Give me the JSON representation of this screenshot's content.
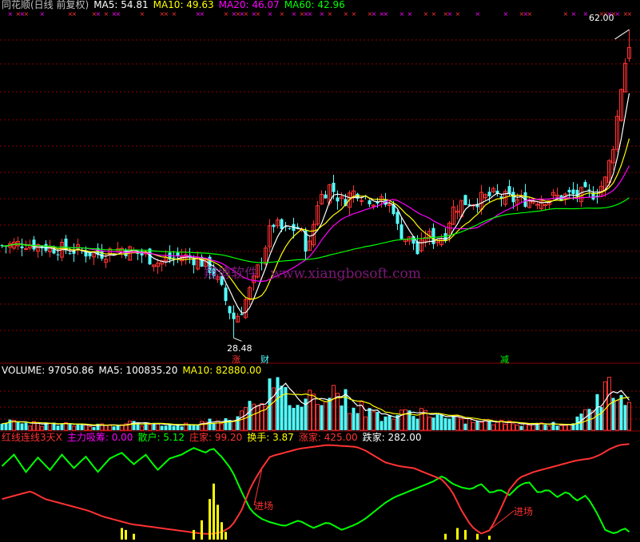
{
  "header_main": {
    "title": "同花顺(日线 前复权)",
    "ma5": "MA5: 54.81",
    "ma10": "MA10: 49.63",
    "ma20": "MA20: 46.07",
    "ma60": "MA60: 42.96"
  },
  "header_volume": {
    "volume": "VOLUME: 97050.86",
    "ma5": "MA5: 100835.20",
    "ma10": "MA10: 82880.00"
  },
  "header_indicator": {
    "name": "红线连线3天X",
    "zlxc": "主力吸筹: 0.00",
    "sanhu": "散户: 5.12",
    "zhuangjia": "庄家: 99.20",
    "huanshou": "换手: 3.87",
    "zhangjia": "涨家: 425.00",
    "diejia": "跌家: 282.00"
  },
  "annotations": {
    "high_price": "62.00",
    "low_price": "28.48",
    "marker_zhang": "涨",
    "marker_cai": "财",
    "marker_jian": "减",
    "entry1": "进场",
    "entry2": "进场"
  },
  "watermark": {
    "cn": "翔博软件",
    "url": "www.xiangbosoft.com"
  },
  "colors": {
    "up": "#ff3232",
    "down": "#54ffff",
    "ma5": "#ffffff",
    "ma10": "#ffff00",
    "ma20": "#ff00ff",
    "ma60": "#00ff00",
    "grid": "#8b0000"
  },
  "chart_data": [
    {
      "type": "candlestick",
      "title": "同花顺(日线 前复权)",
      "ylim": [
        26,
        64
      ],
      "x_count": 158,
      "price_path": [
        [
          0,
          38.5
        ],
        [
          10,
          38.8
        ],
        [
          20,
          38.3
        ],
        [
          30,
          38.0
        ],
        [
          40,
          37.6
        ],
        [
          50,
          38.2
        ],
        [
          60,
          37.4
        ],
        [
          65,
          36.7
        ],
        [
          75,
          37.4
        ],
        [
          82,
          37.0
        ],
        [
          88,
          35.8
        ],
        [
          92,
          33.5
        ],
        [
          95,
          31.5
        ],
        [
          97,
          30.5
        ],
        [
          100,
          31.5
        ],
        [
          105,
          34.5
        ],
        [
          110,
          38.5
        ],
        [
          113,
          41.0
        ],
        [
          118,
          40.0
        ],
        [
          124,
          40.5
        ],
        [
          128,
          37.8
        ],
        [
          132,
          43.5
        ],
        [
          137,
          45.0
        ],
        [
          142,
          43.2
        ],
        [
          145,
          44.0
        ],
        [
          148,
          44.5
        ],
        [
          152,
          43.8
        ],
        [
          157,
          43.4
        ],
        [
          162,
          42.8
        ],
        [
          164,
          42.5
        ],
        [
          165,
          40.5
        ],
        [
          168,
          39.5
        ],
        [
          172,
          38.8
        ],
        [
          174,
          37.4
        ],
        [
          177,
          39.8
        ],
        [
          180,
          39.2
        ],
        [
          185,
          39.6
        ],
        [
          188,
          42.4
        ],
        [
          192,
          43.2
        ],
        [
          198,
          43.4
        ],
        [
          205,
          44.0
        ],
        [
          215,
          43.4
        ],
        [
          225,
          43.6
        ],
        [
          232,
          43.8
        ],
        [
          238,
          44.0
        ],
        [
          248,
          44.2
        ],
        [
          252,
          45.6
        ],
        [
          255,
          49.0
        ],
        [
          257,
          52.5
        ],
        [
          259,
          56.5
        ],
        [
          261,
          59.5
        ],
        [
          262,
          60.5
        ]
      ],
      "high": 62.0,
      "low": 28.48,
      "series": [
        {
          "name": "MA5",
          "last": 54.81
        },
        {
          "name": "MA10",
          "last": 49.63
        },
        {
          "name": "MA20",
          "last": 46.07
        },
        {
          "name": "MA60",
          "last": 42.96
        }
      ]
    },
    {
      "type": "bar",
      "title": "VOLUME",
      "ylim": [
        0,
        140000
      ],
      "vol_path": [
        [
          0,
          22000
        ],
        [
          15,
          16000
        ],
        [
          30,
          14000
        ],
        [
          45,
          13000
        ],
        [
          52,
          22000
        ],
        [
          60,
          15000
        ],
        [
          75,
          14000
        ],
        [
          85,
          20000
        ],
        [
          90,
          30000
        ],
        [
          95,
          22000
        ],
        [
          100,
          60000
        ],
        [
          106,
          85000
        ],
        [
          110,
          95000
        ],
        [
          113,
          110000
        ],
        [
          118,
          90000
        ],
        [
          124,
          65000
        ],
        [
          130,
          92000
        ],
        [
          137,
          110000
        ],
        [
          142,
          85000
        ],
        [
          148,
          60000
        ],
        [
          152,
          50000
        ],
        [
          157,
          40000
        ],
        [
          165,
          35000
        ],
        [
          172,
          50000
        ],
        [
          178,
          45000
        ],
        [
          185,
          30000
        ],
        [
          195,
          24000
        ],
        [
          205,
          20000
        ],
        [
          215,
          18000
        ],
        [
          225,
          17000
        ],
        [
          235,
          16000
        ],
        [
          240,
          24000
        ],
        [
          246,
          60000
        ],
        [
          250,
          85000
        ],
        [
          254,
          110000
        ],
        [
          258,
          120000
        ],
        [
          262,
          100000
        ]
      ],
      "series": [
        {
          "name": "VOLUME",
          "last": 97050.86
        },
        {
          "name": "MA5",
          "last": 100835.2
        },
        {
          "name": "MA10",
          "last": 82880.0
        }
      ]
    },
    {
      "type": "line",
      "title": "红线连线3天X",
      "ylim": [
        0,
        100
      ],
      "series": [
        {
          "name": "散户",
          "last": 5.12,
          "path": [
            [
              0,
              76
            ],
            [
              5,
              88
            ],
            [
              10,
              70
            ],
            [
              15,
              85
            ],
            [
              20,
              72
            ],
            [
              25,
              88
            ],
            [
              30,
              74
            ],
            [
              35,
              86
            ],
            [
              40,
              70
            ],
            [
              45,
              84
            ],
            [
              50,
              90
            ],
            [
              55,
              78
            ],
            [
              60,
              88
            ],
            [
              65,
              72
            ],
            [
              70,
              84
            ],
            [
              75,
              88
            ],
            [
              80,
              95
            ],
            [
              85,
              90
            ],
            [
              88,
              95
            ],
            [
              92,
              85
            ],
            [
              96,
              72
            ],
            [
              100,
              50
            ],
            [
              104,
              30
            ],
            [
              108,
              22
            ],
            [
              112,
              18
            ],
            [
              118,
              14
            ],
            [
              124,
              20
            ],
            [
              130,
              12
            ],
            [
              136,
              18
            ],
            [
              142,
              10
            ],
            [
              148,
              16
            ],
            [
              152,
              22
            ],
            [
              156,
              30
            ],
            [
              160,
              38
            ],
            [
              164,
              44
            ],
            [
              168,
              48
            ],
            [
              172,
              52
            ],
            [
              176,
              56
            ],
            [
              180,
              60
            ],
            [
              184,
              66
            ],
            [
              188,
              58
            ],
            [
              192,
              54
            ],
            [
              196,
              52
            ],
            [
              200,
              58
            ],
            [
              204,
              48
            ],
            [
              208,
              52
            ],
            [
              212,
              46
            ],
            [
              216,
              56
            ],
            [
              220,
              60
            ],
            [
              224,
              48
            ],
            [
              228,
              52
            ],
            [
              232,
              44
            ],
            [
              236,
              50
            ],
            [
              240,
              40
            ],
            [
              244,
              46
            ],
            [
              248,
              30
            ],
            [
              252,
              10
            ],
            [
              256,
              6
            ],
            [
              260,
              12
            ],
            [
              262,
              8
            ]
          ]
        },
        {
          "name": "庄家",
          "last": 99.2,
          "path": [
            [
              0,
              42
            ],
            [
              6,
              46
            ],
            [
              12,
              50
            ],
            [
              18,
              42
            ],
            [
              24,
              38
            ],
            [
              30,
              34
            ],
            [
              36,
              30
            ],
            [
              42,
              24
            ],
            [
              48,
              20
            ],
            [
              54,
              16
            ],
            [
              60,
              14
            ],
            [
              66,
              12
            ],
            [
              72,
              10
            ],
            [
              78,
              8
            ],
            [
              84,
              6
            ],
            [
              88,
              6
            ],
            [
              92,
              8
            ],
            [
              96,
              14
            ],
            [
              100,
              30
            ],
            [
              104,
              55
            ],
            [
              108,
              72
            ],
            [
              112,
              86
            ],
            [
              118,
              90
            ],
            [
              124,
              94
            ],
            [
              130,
              96
            ],
            [
              136,
              98
            ],
            [
              142,
              97
            ],
            [
              148,
              96
            ],
            [
              152,
              92
            ],
            [
              156,
              86
            ],
            [
              160,
              80
            ],
            [
              166,
              76
            ],
            [
              172,
              74
            ],
            [
              178,
              68
            ],
            [
              184,
              62
            ],
            [
              188,
              50
            ],
            [
              192,
              30
            ],
            [
              196,
              14
            ],
            [
              200,
              6
            ],
            [
              204,
              10
            ],
            [
              208,
              30
            ],
            [
              212,
              52
            ],
            [
              216,
              64
            ],
            [
              222,
              70
            ],
            [
              228,
              74
            ],
            [
              234,
              78
            ],
            [
              240,
              82
            ],
            [
              246,
              84
            ],
            [
              250,
              88
            ],
            [
              254,
              94
            ],
            [
              258,
              98
            ],
            [
              262,
              99
            ]
          ]
        },
        {
          "name": "主力吸筹",
          "last": 0.0,
          "peaks": [
            [
              50,
              12
            ],
            [
              52,
              10
            ],
            [
              55,
              6
            ],
            [
              80,
              10
            ],
            [
              84,
              20
            ],
            [
              86,
              42
            ],
            [
              88,
              58
            ],
            [
              90,
              36
            ],
            [
              92,
              18
            ],
            [
              94,
              8
            ],
            [
              186,
              6
            ],
            [
              190,
              12
            ],
            [
              194,
              10
            ],
            [
              198,
              6
            ],
            [
              203,
              4
            ]
          ]
        }
      ]
    }
  ]
}
